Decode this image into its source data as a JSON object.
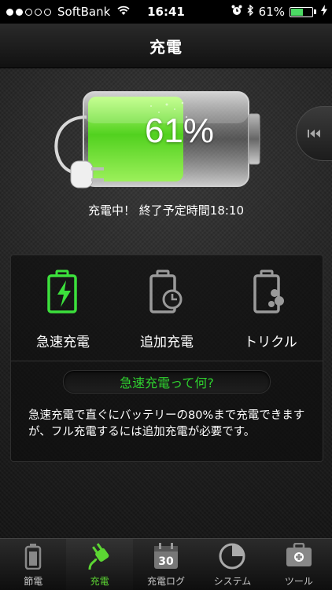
{
  "status_bar": {
    "carrier": "SoftBank",
    "time": "16:41",
    "battery_pct": "61%",
    "battery_level": 0.61,
    "signal_bars": 2
  },
  "navbar": {
    "title": "充電"
  },
  "battery": {
    "percent_text": "61%",
    "level": 0.61,
    "status_text": "充電中！ 終了予定時間18:10"
  },
  "modes": [
    {
      "label": "急速充電",
      "icon": "battery-bolt-icon",
      "active": true
    },
    {
      "label": "追加充電",
      "icon": "battery-clock-icon",
      "active": false
    },
    {
      "label": "トリクル",
      "icon": "battery-bubbles-icon",
      "active": false
    }
  ],
  "help": {
    "button_label": "急速充電って何?",
    "description": "急速充電で直ぐにバッテリーの80%まで充電できますが、フル充電するには追加充電が必要です。"
  },
  "tabbar": {
    "tabs": [
      {
        "label": "節電",
        "icon": "battery-icon"
      },
      {
        "label": "充電",
        "icon": "plug-icon"
      },
      {
        "label": "充電ログ",
        "icon": "calendar-icon"
      },
      {
        "label": "システム",
        "icon": "pie-chart-icon"
      },
      {
        "label": "ツール",
        "icon": "toolbox-icon"
      }
    ],
    "active_index": 1
  },
  "colors": {
    "accent_green": "#2fd12f",
    "battery_green": "#6ee84a",
    "status_battery": "#4cd964"
  }
}
